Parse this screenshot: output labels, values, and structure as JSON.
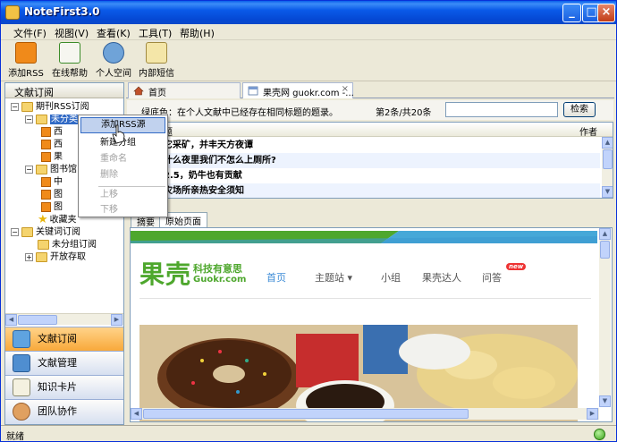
{
  "window": {
    "title": "NoteFirst3.0"
  },
  "menubar": [
    "文件(F)",
    "视图(V)",
    "查看(K)",
    "工具(T)",
    "帮助(H)"
  ],
  "toolbar": {
    "add_rss": "添加RSS",
    "online_help": "在线帮助",
    "personal_space": "个人空间",
    "internal_message": "内部短信"
  },
  "left_panel": {
    "header": "文献订阅",
    "tree": {
      "journal_rss": "期刊RSS订阅",
      "uncategorized": "未分类",
      "rss_1": "西",
      "rss_2": "西",
      "rss_3": "果",
      "library": "图书馆",
      "lib_1": "中",
      "lib_2": "图",
      "lib_3": "图",
      "favorites": "收藏夹",
      "keyword_sub": "关键词订阅",
      "kw_uncategorized": "未分组订阅",
      "open_access": "开放存取"
    },
    "nav": [
      "文献订阅",
      "文献管理",
      "知识卡片",
      "团队协作"
    ]
  },
  "context_menu": {
    "items": [
      {
        "label": "添加RSS源",
        "enabled": true,
        "highlighted": true
      },
      {
        "label": "新建分组",
        "enabled": true
      },
      {
        "label": "重命名",
        "enabled": false
      },
      {
        "label": "删除",
        "enabled": false
      },
      {
        "label": "上移",
        "enabled": false
      },
      {
        "label": "下移",
        "enabled": false
      }
    ]
  },
  "tabs": [
    {
      "label": "首页",
      "active": false
    },
    {
      "label": "果壳网 guokr.com -...",
      "active": true,
      "close": "×"
    }
  ],
  "filter": {
    "note": "绿底色：在个人文献中已经存在相同标题的题录。",
    "count": "第2条/共20条",
    "search_value": "",
    "search_button": "检索"
  },
  "list": {
    "header_title": "题",
    "header_author": "作者",
    "rows": [
      "它采矿，并丰天方夜谭",
      "什么夜里我们不怎么上厕所?",
      "2.5，奶牛也有贡献",
      "灾场所亲热安全须知"
    ]
  },
  "subtabs": [
    "摘要",
    "原始页面"
  ],
  "webpage": {
    "logo_cn": "果壳",
    "logo_slogan": "科技有意思",
    "logo_domain": "Guokr.com",
    "nav": [
      "首页",
      "主题站",
      "小组",
      "果壳达人",
      "问答"
    ],
    "new_badge": "new",
    "caret": "▾"
  },
  "status": {
    "text": "就绪"
  },
  "colors": {
    "title_blue": "#0a5ae8",
    "guokr_green": "#4ea72d",
    "selection": "#316ac5"
  }
}
